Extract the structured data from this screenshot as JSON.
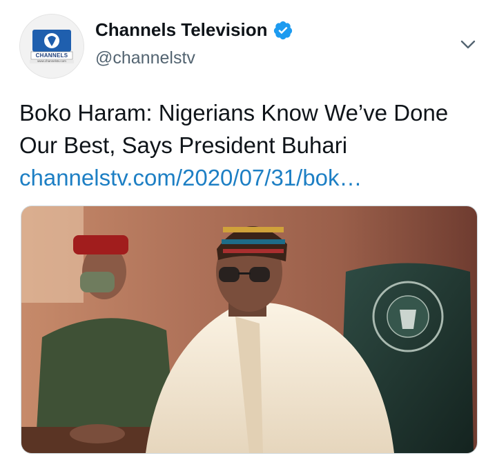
{
  "author": {
    "name": "Channels Television",
    "handle": "@channelstv",
    "verified": true,
    "avatar_label": "CHANNELS",
    "avatar_sub": "www.channelstv.com"
  },
  "tweet": {
    "text_line1": "Boko Haram: Nigerians Know We’ve Done",
    "text_line2": "Our Best, Says President Buhari",
    "link": "channelstv.com/2020/07/31/bok…"
  },
  "colors": {
    "link": "#1d7fc4",
    "verified_badge": "#1d9bf0",
    "text": "#0f1419",
    "muted": "#536471"
  },
  "icons": [
    "verified-badge-icon",
    "chevron-down-icon"
  ],
  "media": {
    "alt_description_present": false
  }
}
